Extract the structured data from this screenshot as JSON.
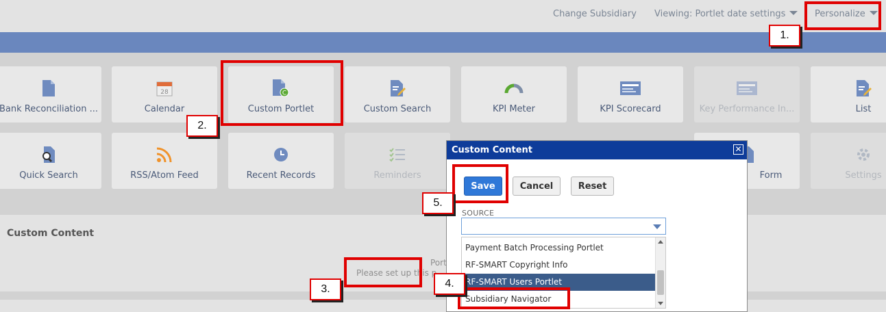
{
  "header": {
    "change_subsidiary": "Change Subsidiary",
    "viewing": "Viewing: Portlet date settings",
    "personalize": "Personalize"
  },
  "tiles_row1": [
    {
      "label": "Bank Reconciliation ...",
      "icon": "document-icon",
      "disabled": false
    },
    {
      "label": "Calendar",
      "icon": "calendar-icon",
      "disabled": false
    },
    {
      "label": "Custom Portlet",
      "icon": "custom-portlet-icon",
      "disabled": false
    },
    {
      "label": "Custom Search",
      "icon": "search-edit-icon",
      "disabled": false
    },
    {
      "label": "KPI Meter",
      "icon": "gauge-icon",
      "disabled": false
    },
    {
      "label": "KPI Scorecard",
      "icon": "scorecard-icon",
      "disabled": false
    },
    {
      "label": "Key Performance In...",
      "icon": "scorecard-icon",
      "disabled": true
    },
    {
      "label": "List",
      "icon": "list-edit-icon",
      "disabled": false
    }
  ],
  "tiles_row2": [
    {
      "label": "Quick Search",
      "icon": "magnifier-icon",
      "disabled": false
    },
    {
      "label": "RSS/Atom Feed",
      "icon": "rss-icon",
      "disabled": false
    },
    {
      "label": "Recent Records",
      "icon": "clock-icon",
      "disabled": false
    },
    {
      "label": "Reminders",
      "icon": "checklist-icon",
      "disabled": true
    },
    {
      "label": "Form",
      "icon": "form-icon",
      "disabled": false
    },
    {
      "label": "Settings",
      "icon": "gear-icon",
      "disabled": true
    }
  ],
  "calendar_day": "28",
  "custom_content": {
    "title": "Custom Content",
    "message": "Please set up this p",
    "message_partial": "Port"
  },
  "dialog": {
    "title": "Custom Content",
    "close": "✕",
    "save": "Save",
    "cancel": "Cancel",
    "reset": "Reset",
    "source_label": "SOURCE",
    "source_value": "",
    "options": [
      {
        "label": "Payment Batch Processing Portlet",
        "selected": false
      },
      {
        "label": "RF-SMART Copyright Info",
        "selected": false
      },
      {
        "label": "RF-SMART Users Portlet",
        "selected": true
      },
      {
        "label": "Subsidiary Navigator",
        "selected": false
      }
    ]
  },
  "callouts": [
    "1.",
    "2.",
    "3.",
    "4.",
    "5."
  ],
  "colors": {
    "accent_band": "#6a87be",
    "dialog_header": "#0e3c9a",
    "save_button": "#2f78d8",
    "highlight": "#e00000",
    "selected_option": "#3b5c8a"
  }
}
